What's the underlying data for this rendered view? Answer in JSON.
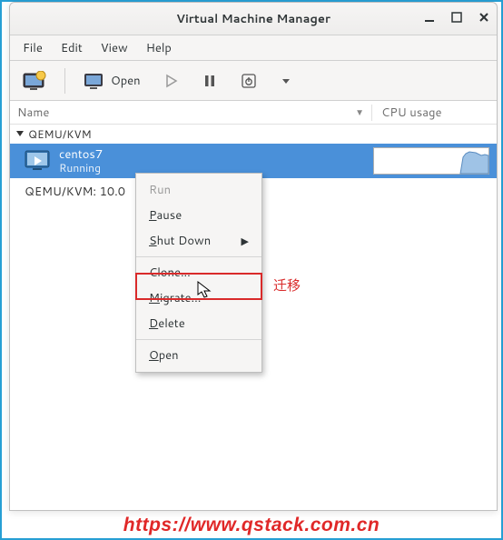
{
  "window": {
    "title": "Virtual Machine Manager"
  },
  "menubar": {
    "file": "File",
    "edit": "Edit",
    "view": "View",
    "help": "Help"
  },
  "toolbar": {
    "open": "Open"
  },
  "columns": {
    "name": "Name",
    "cpu": "CPU usage"
  },
  "tree": {
    "group1": "QEMU/KVM",
    "vm1": {
      "name": "centos7",
      "status": "Running"
    },
    "group2": "QEMU/KVM: 10.0"
  },
  "ctxmenu": {
    "run": "Run",
    "pause": "Pause",
    "shutdown": "Shut Down",
    "clone": "Clone...",
    "migrate": "Migrate...",
    "delete": "Delete",
    "open": "Open"
  },
  "annotation": {
    "migrate_cn": "迁移"
  },
  "footer": {
    "url": "https://www.qstack.com.cn"
  }
}
